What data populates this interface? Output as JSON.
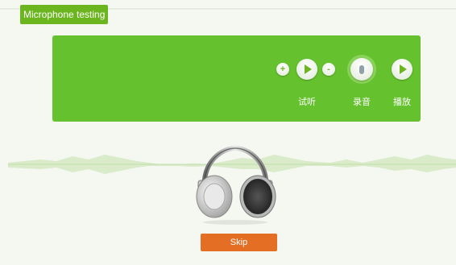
{
  "header": {
    "title": "Microphone testing"
  },
  "controls": {
    "volume_up_glyph": "+",
    "volume_down_glyph": "-",
    "preview_label": "试听",
    "record_label": "录音",
    "play_label": "播放"
  },
  "footer": {
    "skip_label": "Skip"
  },
  "colors": {
    "panel": "#65c22e",
    "title_tab": "#6bb61f",
    "skip_button": "#e46f24"
  }
}
